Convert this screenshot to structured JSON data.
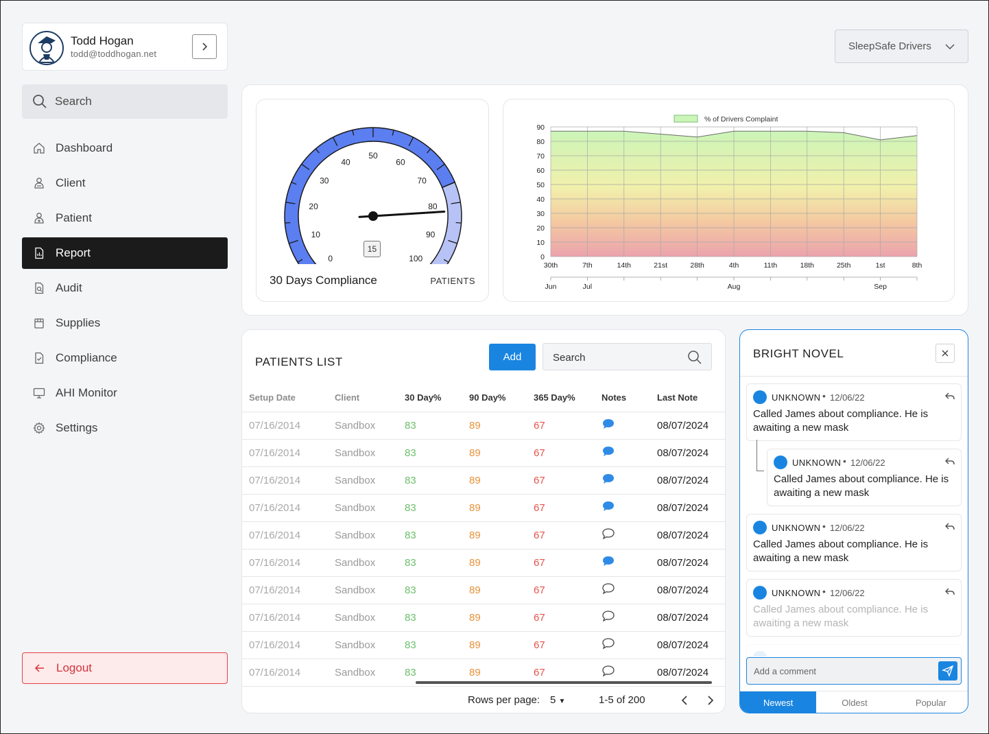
{
  "profile": {
    "name": "Todd Hogan",
    "email": "todd@toddhogan.net"
  },
  "sidebar": {
    "search_placeholder": "Search",
    "items": [
      {
        "label": "Dashboard",
        "icon": "home-icon"
      },
      {
        "label": "Client",
        "icon": "client-icon"
      },
      {
        "label": "Patient",
        "icon": "patient-icon"
      },
      {
        "label": "Report",
        "icon": "report-icon",
        "active": true
      },
      {
        "label": "Audit",
        "icon": "audit-icon"
      },
      {
        "label": "Supplies",
        "icon": "supplies-icon"
      },
      {
        "label": "Compliance",
        "icon": "compliance-icon"
      },
      {
        "label": "AHI Monitor",
        "icon": "monitor-icon"
      },
      {
        "label": "Settings",
        "icon": "gear-icon"
      }
    ],
    "logout_label": "Logout"
  },
  "org_select": {
    "value": "SleepSafe Drivers"
  },
  "gauge": {
    "title": "30 Days Compliance",
    "subtitle": "PATIENTS",
    "value": 15,
    "ticks": [
      "0",
      "10",
      "20",
      "30",
      "40",
      "50",
      "60",
      "70",
      "80",
      "90",
      "100"
    ],
    "needle_value": 82,
    "colors": {
      "high": "#5b7ef0",
      "low": "#b7c3f6"
    }
  },
  "chart_data": {
    "type": "area",
    "legend": "% of Drivers Complaint",
    "legend_placement": "top",
    "x_major": [
      "30th",
      "7th",
      "14th",
      "21st",
      "28th",
      "4th",
      "11th",
      "18th",
      "25th",
      "1st",
      "8th"
    ],
    "x_months": [
      {
        "label": "Jun",
        "index": 0
      },
      {
        "label": "Jul",
        "index": 1
      },
      {
        "label": "Aug",
        "index": 5
      },
      {
        "label": "Sep",
        "index": 9
      }
    ],
    "values": [
      87,
      87,
      87,
      85,
      83,
      87,
      87,
      87,
      86,
      81,
      84
    ],
    "ylim": [
      0,
      90
    ],
    "yticks": [
      "0",
      "10",
      "20",
      "30",
      "40",
      "50",
      "60",
      "70",
      "80",
      "90"
    ],
    "grid": true
  },
  "patients": {
    "title": "PATIENTS LIST",
    "add_label": "Add",
    "search_placeholder": "Search",
    "columns": [
      "Setup Date",
      "Client",
      "30 Day%",
      "90 Day%",
      "365 Day%",
      "Notes",
      "Last Note"
    ],
    "rows": [
      {
        "setup": "07/16/2014",
        "client": "Sandbox",
        "d30": "83",
        "d90": "89",
        "d365": "67",
        "notes": "filled",
        "last": "08/07/2024"
      },
      {
        "setup": "07/16/2014",
        "client": "Sandbox",
        "d30": "83",
        "d90": "89",
        "d365": "67",
        "notes": "filled",
        "last": "08/07/2024"
      },
      {
        "setup": "07/16/2014",
        "client": "Sandbox",
        "d30": "83",
        "d90": "89",
        "d365": "67",
        "notes": "filled",
        "last": "08/07/2024"
      },
      {
        "setup": "07/16/2014",
        "client": "Sandbox",
        "d30": "83",
        "d90": "89",
        "d365": "67",
        "notes": "filled",
        "last": "08/07/2024"
      },
      {
        "setup": "07/16/2014",
        "client": "Sandbox",
        "d30": "83",
        "d90": "89",
        "d365": "67",
        "notes": "outline",
        "last": "08/07/2024"
      },
      {
        "setup": "07/16/2014",
        "client": "Sandbox",
        "d30": "83",
        "d90": "89",
        "d365": "67",
        "notes": "filled",
        "last": "08/07/2024"
      },
      {
        "setup": "07/16/2014",
        "client": "Sandbox",
        "d30": "83",
        "d90": "89",
        "d365": "67",
        "notes": "outline",
        "last": "08/07/2024"
      },
      {
        "setup": "07/16/2014",
        "client": "Sandbox",
        "d30": "83",
        "d90": "89",
        "d365": "67",
        "notes": "outline",
        "last": "08/07/2024"
      },
      {
        "setup": "07/16/2014",
        "client": "Sandbox",
        "d30": "83",
        "d90": "89",
        "d365": "67",
        "notes": "outline",
        "last": "08/07/2024"
      },
      {
        "setup": "07/16/2014",
        "client": "Sandbox",
        "d30": "83",
        "d90": "89",
        "d365": "67",
        "notes": "outline",
        "last": "08/07/2024"
      }
    ],
    "pager": {
      "label": "Rows per page:",
      "size": "5",
      "range": "1-5 of 200"
    }
  },
  "comments": {
    "title": "BRIGHT NOVEL",
    "items": [
      {
        "author": "UNKNOWN",
        "date": "12/06/22",
        "text": "Called James about compliance. He is awaiting a new mask"
      },
      {
        "author": "UNKNOWN",
        "date": "12/06/22",
        "text": "Called James about compliance. He is awaiting a new mask",
        "reply": true
      },
      {
        "author": "UNKNOWN",
        "date": "12/06/22",
        "text": "Called James about compliance. He is awaiting a new mask"
      },
      {
        "author": "UNKNOWN",
        "date": "12/06/22",
        "text": "Called James about compliance. He is awaiting a new mask",
        "faded": true
      }
    ],
    "input_placeholder": "Add a comment",
    "tabs": [
      "Newest",
      "Oldest",
      "Popular"
    ],
    "active_tab": "Newest"
  }
}
